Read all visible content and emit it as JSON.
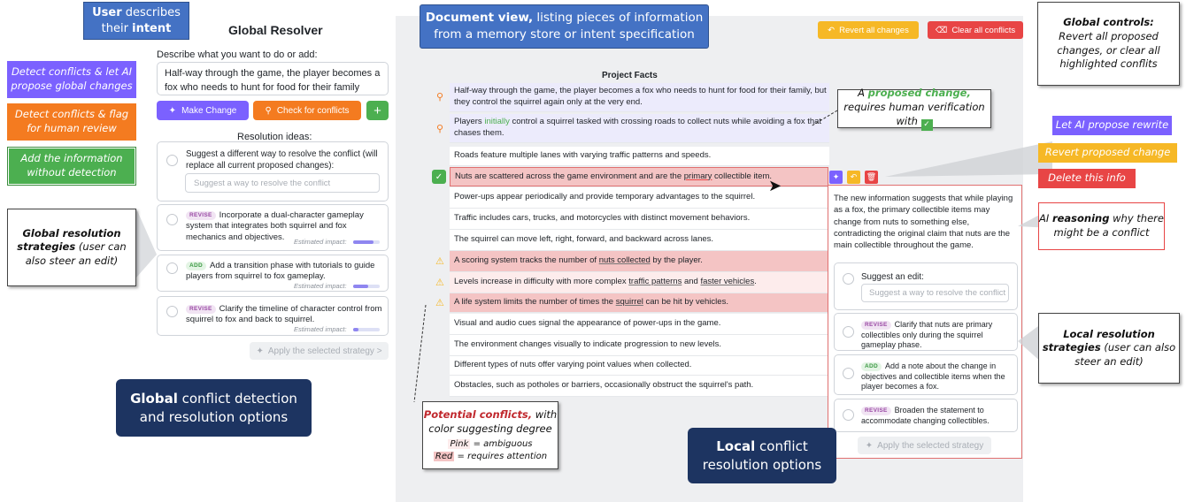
{
  "left_panel": {
    "title": "Global Resolver",
    "intent_label": "Describe what you want to do or add:",
    "intent_text": "Half-way through the game, the player becomes a fox who needs to hunt for food for their family",
    "make_change_label": "Make Change",
    "check_conflicts_label": "Check for conflicts",
    "add_label": "+",
    "resolution_heading": "Resolution ideas:",
    "suggest_label": "Suggest a different way to resolve the conflict (will replace all current proposed changes):",
    "suggest_placeholder": "Suggest a way to resolve the conflict",
    "ideas": [
      {
        "tag": "REVISE",
        "text": "Incorporate a dual-character gameplay system that integrates both squirrel and fox mechanics and objectives.",
        "impact_label": "Estimated impact:",
        "impact": 0.75
      },
      {
        "tag": "ADD",
        "text": "Add a transition phase with tutorials to guide players from squirrel to fox gameplay.",
        "impact_label": "Estimated impact:",
        "impact": 0.55
      },
      {
        "tag": "REVISE",
        "text": "Clarify the timeline of character control from squirrel to fox and back to squirrel.",
        "impact_label": "Estimated impact:",
        "impact": 0.2
      }
    ],
    "apply_label": "Apply the selected strategy >"
  },
  "document": {
    "title": "Project Facts",
    "revert_all_label": "Revert all changes",
    "clear_all_label": "Clear all conflicts",
    "rows": [
      {
        "text": "Half-way through the game, the player becomes a fox who needs to hunt for food for their family, but they control the squirrel again only at the very end."
      },
      {
        "pre": "Players ",
        "highlight": "initially",
        "post": " control a squirrel tasked with crossing roads to collect nuts while avoiding a fox that chases them."
      },
      {
        "text": "Roads feature multiple lanes with varying traffic patterns and speeds."
      },
      {
        "pre": "Nuts are scattered across the game environment and are the ",
        "highlight": "primary",
        "post": " collectible item."
      },
      {
        "text": "Power-ups appear periodically and provide temporary advantages to the squirrel."
      },
      {
        "text": "Traffic includes cars, trucks, and motorcycles with distinct movement behaviors."
      },
      {
        "text": "The squirrel can move left, right, forward, and backward across lanes."
      },
      {
        "pre": "A scoring system tracks the number of ",
        "highlight": "nuts collected",
        "post": " by the player."
      },
      {
        "pre": "Levels increase in difficulty with more complex ",
        "highlight": "traffic patterns",
        "mid": " and ",
        "highlight2": "faster vehicles",
        "post": "."
      },
      {
        "pre": "A life system limits the number of times the ",
        "highlight": "squirrel",
        "post": " can be hit by vehicles."
      },
      {
        "text": "Visual and audio cues signal the appearance of power-ups in the game."
      },
      {
        "text": "The environment changes visually to indicate progression to new levels."
      },
      {
        "text": "Different types of nuts offer varying point values when collected."
      },
      {
        "text": "Obstacles, such as potholes or barriers, occasionally obstruct the squirrel's path."
      }
    ]
  },
  "local_panel": {
    "reasoning": "The new information suggests that while playing as a fox, the primary collectible items may change from nuts to something else, contradicting the original claim that nuts are the main collectible throughout the game.",
    "suggest_label": "Suggest an edit:",
    "suggest_placeholder": "Suggest a way to resolve the conflict",
    "ideas": [
      {
        "tag": "REVISE",
        "text": "Clarify that nuts are primary collectibles only during the squirrel gameplay phase."
      },
      {
        "tag": "ADD",
        "text": "Add a note about the change in objectives and collectible items when the player becomes a fox."
      },
      {
        "tag": "REVISE",
        "text": "Broaden the statement to accommodate changing collectibles."
      }
    ],
    "apply_label": "Apply the selected strategy"
  },
  "annotations": {
    "user_intent": {
      "b1": "User",
      "t1": " describes",
      "t2": "their ",
      "b2": "intent"
    },
    "detect_propose": "Detect conflicts & let AI propose global changes",
    "detect_flag": "Detect conflicts & flag for human review",
    "add_info": "Add the information without detection",
    "global_strategies": {
      "b": "Global resolution strategies",
      "t": " (user can also steer an edit)"
    },
    "global_options": {
      "b": "Global",
      "t": " conflict detection and resolution options"
    },
    "doc_view": {
      "b": "Document view,",
      "t": " listing pieces of information from a memory store or intent specification"
    },
    "proposed_change": {
      "t1": "A ",
      "b": "proposed change,",
      "t2": " requires human verification with"
    },
    "potential_conflicts": {
      "b": "Potential conflicts,",
      "t": " with color suggesting degree",
      "pink": "Pink",
      "pink_t": " = ambiguous",
      "red": "Red",
      "red_t": " = requires attention"
    },
    "local_options": {
      "b": "Local",
      "t": " conflict resolution options"
    },
    "global_controls": {
      "b": "Global controls:",
      "t": "Revert all proposed changes, or clear all highlighted conflits"
    },
    "ai_rewrite": "Let AI propose rewrite",
    "revert_proposed": "Revert proposed change",
    "delete_info": "Delete this info",
    "ai_reasoning": {
      "t1": "AI ",
      "b": "reasoning",
      "t2": " why there might be a conflict"
    },
    "local_strategies": {
      "b": "Local resolution strategies",
      "t": " (user can also steer an edit)"
    }
  },
  "colors": {
    "purple": "#7b61ff",
    "orange": "#f47b20",
    "green": "#4caf50",
    "red": "#e84545",
    "yellow": "#f6b826",
    "blue": "#4472c4",
    "navy": "#1d3461"
  }
}
